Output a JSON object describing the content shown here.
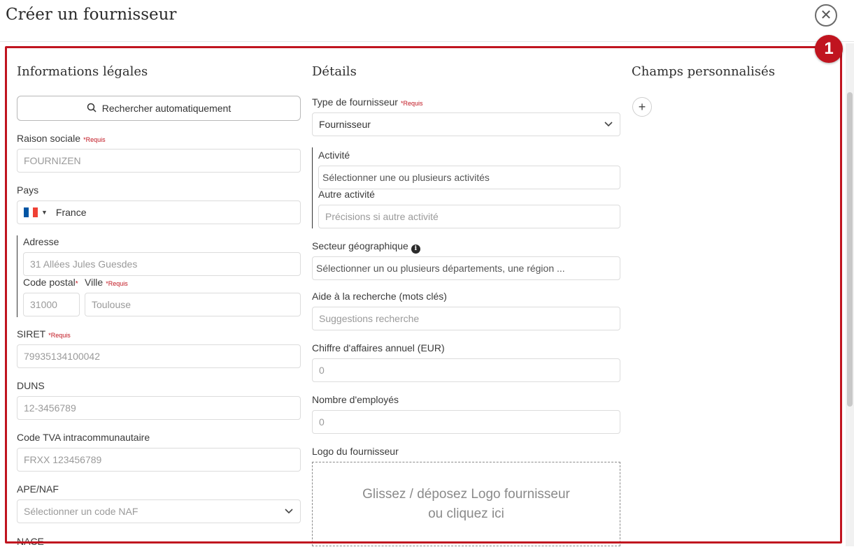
{
  "modal": {
    "title": "Créer un fournisseur",
    "close_icon": "close-icon",
    "badge": "1"
  },
  "legal": {
    "title": "Informations légales",
    "search_button": "Rechercher automatiquement",
    "raison_sociale": {
      "label": "Raison sociale",
      "required": "*Requis",
      "placeholder": "FOURNIZEN"
    },
    "pays": {
      "label": "Pays",
      "value": "France",
      "flag_colors": [
        "#0055a4",
        "#ffffff",
        "#ef4135"
      ]
    },
    "adresse": {
      "label": "Adresse",
      "placeholder": "31 Allées Jules Guesdes"
    },
    "code_postal": {
      "label": "Code postal",
      "required_mark": "*",
      "placeholder": "31000"
    },
    "ville": {
      "label": "Ville",
      "required": "*Requis",
      "placeholder": "Toulouse"
    },
    "siret": {
      "label": "SIRET",
      "required": "*Requis",
      "placeholder": "79935134100042"
    },
    "duns": {
      "label": "DUNS",
      "placeholder": "12-3456789"
    },
    "tva": {
      "label": "Code TVA intracommunautaire",
      "placeholder": "FRXX 123456789"
    },
    "ape": {
      "label": "APE/NAF",
      "placeholder": "Sélectionner un code NAF"
    },
    "nace": {
      "label": "NACE"
    }
  },
  "details": {
    "title": "Détails",
    "type": {
      "label": "Type de fournisseur",
      "required": "*Requis",
      "value": "Fournisseur"
    },
    "activite": {
      "label": "Activité",
      "placeholder": "Sélectionner une ou plusieurs activités"
    },
    "autre_activite": {
      "label": "Autre activité",
      "placeholder": "Précisions si autre activité"
    },
    "secteur": {
      "label": "Secteur géographique",
      "info": "i",
      "placeholder": "Sélectionner un ou plusieurs départements, une région ..."
    },
    "aide": {
      "label": "Aide à la recherche (mots clés)",
      "placeholder": "Suggestions recherche"
    },
    "ca": {
      "label": "Chiffre d'affaires annuel (EUR)",
      "placeholder": "0"
    },
    "employes": {
      "label": "Nombre d'employés",
      "placeholder": "0"
    },
    "logo": {
      "label": "Logo du fournisseur",
      "drop_line1": "Glissez / déposez Logo fournisseur",
      "drop_line2": "ou cliquez ici"
    }
  },
  "custom": {
    "title": "Champs personnalisés",
    "add_label": "+"
  },
  "colors": {
    "accent": "#c0141f",
    "border": "#dcdcdc"
  }
}
